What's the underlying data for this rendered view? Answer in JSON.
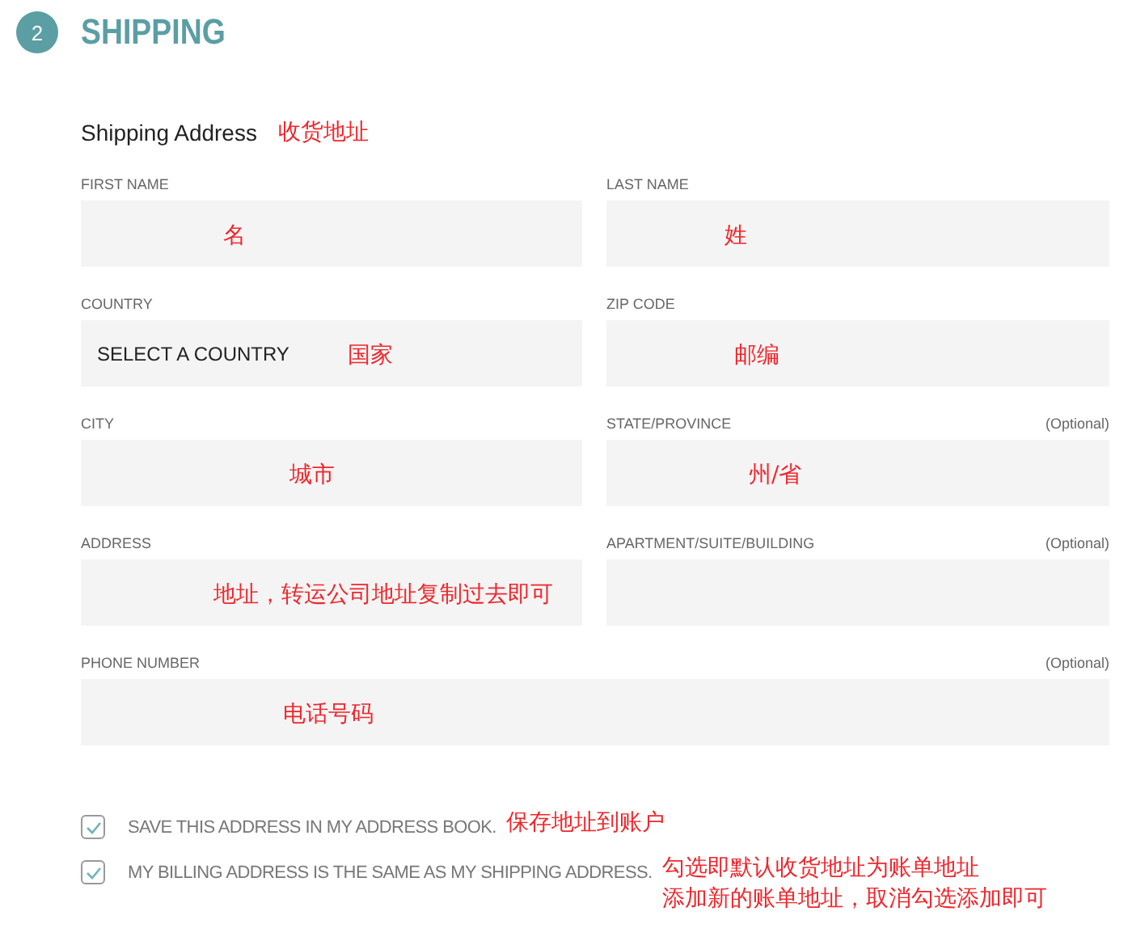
{
  "step": {
    "number": "2",
    "title": "SHIPPING"
  },
  "section": {
    "title": "Shipping Address",
    "note": "收货地址"
  },
  "fields": [
    {
      "label": "FIRST NAME",
      "note": "名"
    },
    {
      "label": "LAST NAME",
      "note": "姓"
    },
    {
      "label": "COUNTRY",
      "value": "SELECT A COUNTRY",
      "note": "国家"
    },
    {
      "label": "ZIP CODE",
      "note": "邮编"
    },
    {
      "label": "CITY",
      "note": "城市"
    },
    {
      "label": "STATE/PROVINCE",
      "optional": "(Optional)",
      "note": "州/省"
    },
    {
      "label": "ADDRESS",
      "note": "地址，转运公司地址复制过去即可"
    },
    {
      "label": "APARTMENT/SUITE/BUILDING",
      "optional": "(Optional)"
    },
    {
      "label": "PHONE NUMBER",
      "optional": "(Optional)",
      "note": "电话号码",
      "wide": true
    }
  ],
  "options": [
    {
      "label": "SAVE THIS ADDRESS IN MY ADDRESS BOOK.",
      "checked": true,
      "notes": [
        "保存地址到账户"
      ]
    },
    {
      "label": "MY BILLING ADDRESS IS THE SAME AS MY SHIPPING ADDRESS.",
      "checked": true,
      "notes": [
        "勾选即默认收货地址为账单地址",
        "添加新的账单地址，取消勾选添加即可"
      ]
    }
  ]
}
